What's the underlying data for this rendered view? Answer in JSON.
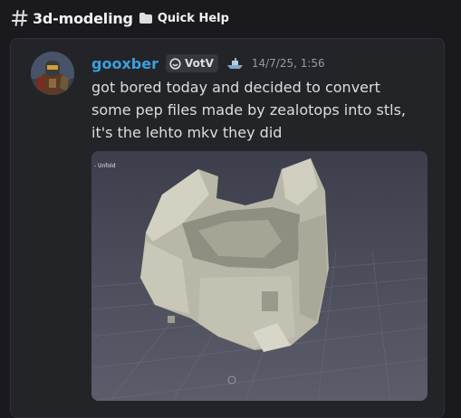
{
  "channel": {
    "icon": "hash-icon",
    "name": "3d-modeling",
    "breadcrumb_icon": "folder-icon",
    "breadcrumb_label": "Quick Help"
  },
  "message": {
    "author": "gooxber",
    "author_color": "#3aa0e0",
    "tag": {
      "icon": "tag-icon",
      "label": "VotV"
    },
    "role_icon": "ship-icon",
    "timestamp": "14/7/25, 1:56",
    "lines": [
      "got bored today and decided to convert",
      "some pep files made by zealotops into stls,",
      "it's the lehto mkv they did"
    ],
    "attachment": {
      "viewport_label": "- Unfold"
    }
  }
}
